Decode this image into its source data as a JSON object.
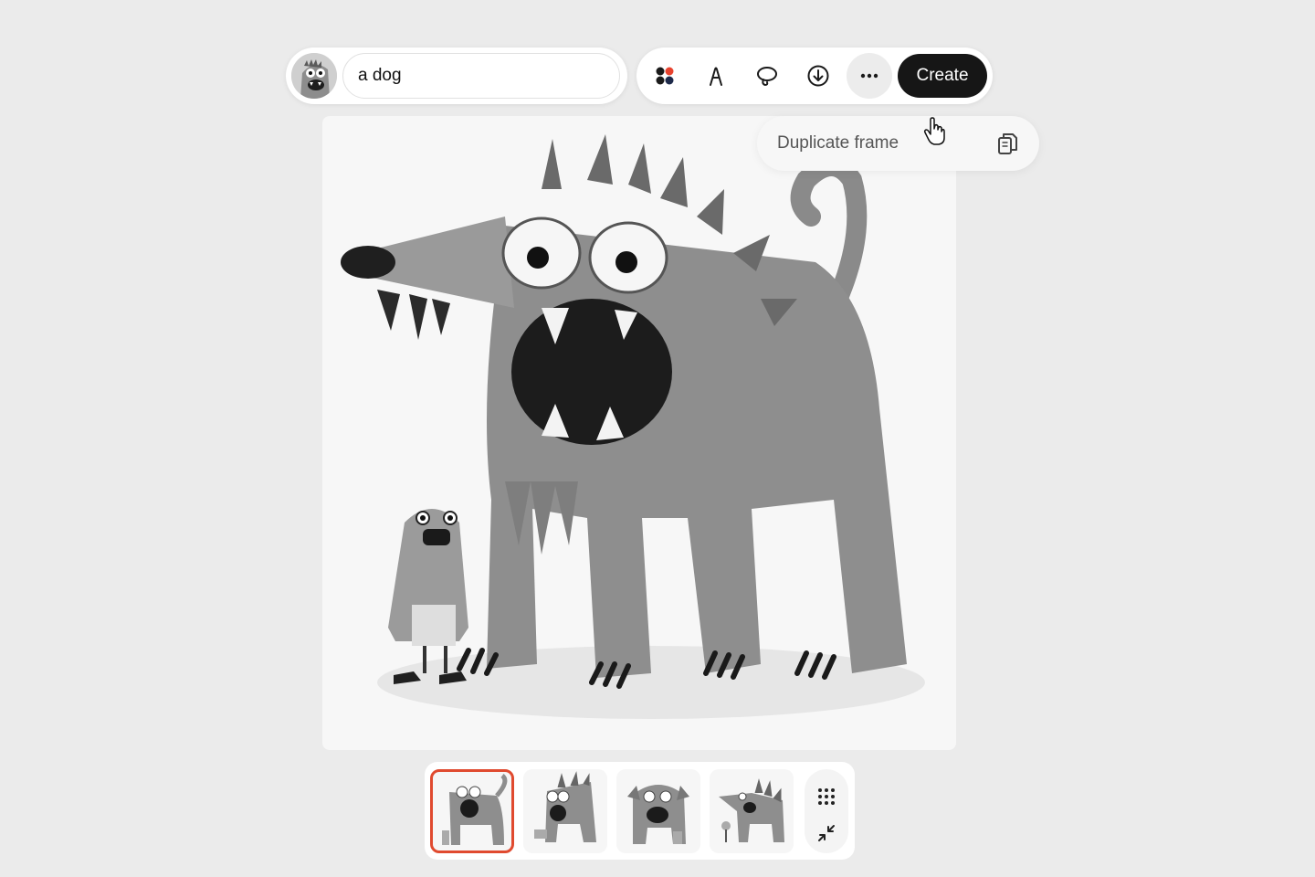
{
  "prompt": {
    "value": "a dog",
    "avatar_icon": "monster-avatar-icon"
  },
  "toolbar": {
    "palette_icon": "color-palette-icon",
    "pen_icon": "pen-tool-icon",
    "lasso_icon": "lasso-icon",
    "download_icon": "download-icon",
    "more_icon": "more-icon",
    "create_label": "Create"
  },
  "tooltip": {
    "label": "Duplicate frame",
    "icon": "copy-icon"
  },
  "canvas": {
    "image_icon": "monster-dog-illustration"
  },
  "thumbnails": [
    {
      "selected": true
    },
    {
      "selected": false
    },
    {
      "selected": false
    },
    {
      "selected": false
    }
  ],
  "strip_controls": {
    "grid_icon": "grid-icon",
    "collapse_icon": "collapse-icon"
  },
  "colors": {
    "background": "#ebebeb",
    "create_button": "#161616",
    "selected_border": "#e04a2f",
    "palette_red": "#e8432f",
    "palette_dark": "#1a1a1a",
    "palette_navy": "#1e2a4a"
  }
}
